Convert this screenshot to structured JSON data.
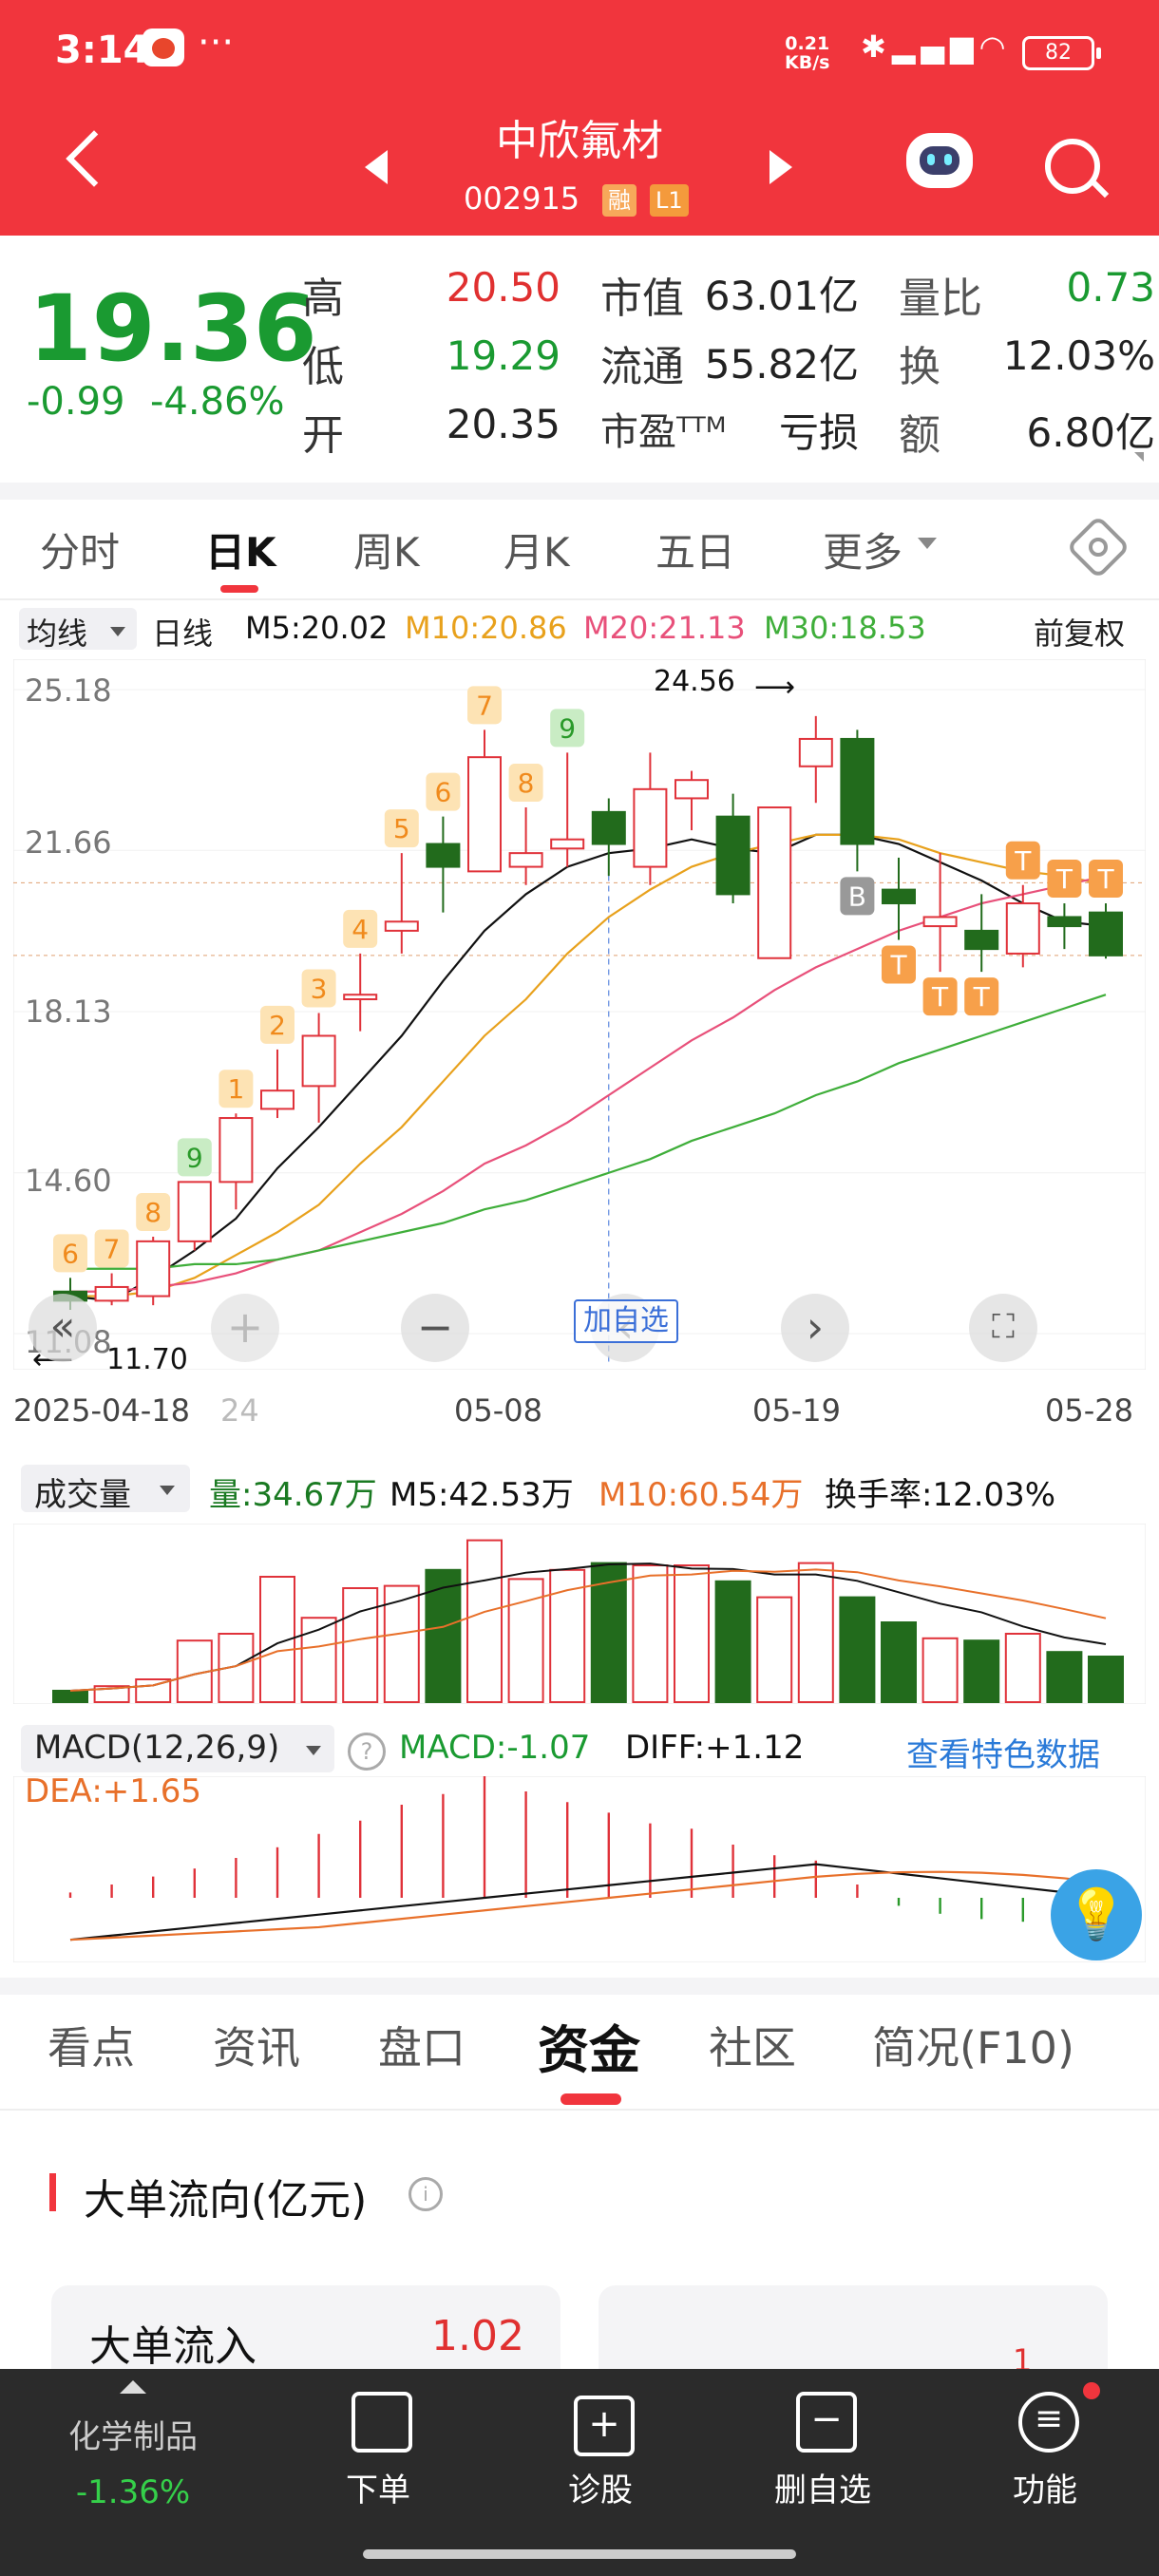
{
  "status_bar": {
    "time": "3:14",
    "dots": "···",
    "net_speed_value": "0.21",
    "net_speed_unit": "KB/s",
    "battery": "82"
  },
  "header": {
    "stock_name": "中欣氟材",
    "stock_code": "002915",
    "tag_margin": "融",
    "tag_level": "L1"
  },
  "quote": {
    "price": "19.36",
    "change": "-0.99",
    "change_pct": "-4.86%",
    "high_label": "高",
    "high": "20.50",
    "low_label": "低",
    "low": "19.29",
    "open_label": "开",
    "open": "20.35",
    "mkt_cap_label": "市值",
    "mkt_cap": "63.01亿",
    "float_cap_label": "流通",
    "float_cap": "55.82亿",
    "pe_label": "市盈ᵀᵀᴹ",
    "pe": "亏损",
    "vol_ratio_label": "量比",
    "vol_ratio": "0.73",
    "turnover_label": "换",
    "turnover": "12.03%",
    "amount_label": "额",
    "amount": "6.80亿"
  },
  "kline_tabs": [
    "分时",
    "日K",
    "周K",
    "月K",
    "五日",
    "更多"
  ],
  "kline_active": 1,
  "ma_bar": {
    "selector": "均线",
    "period": "日线",
    "m5": "M5:20.02",
    "m10": "M10:20.86",
    "m20": "M20:21.13",
    "m30": "M30:18.53",
    "adjust": "前复权"
  },
  "price_axis": [
    "25.18",
    "21.66",
    "18.13",
    "14.60",
    "11.08"
  ],
  "max_label": "24.56",
  "min_label": "11.70",
  "date_axis": [
    "2025-04-18",
    "24",
    "05-08",
    "05-19",
    "05-28"
  ],
  "chart_controls": {
    "add_watch": "加自选"
  },
  "candles": [
    {
      "o": 12.0,
      "c": 11.8,
      "h": 12.3,
      "l": 11.6
    },
    {
      "o": 11.8,
      "c": 12.1,
      "h": 12.4,
      "l": 11.7
    },
    {
      "o": 11.9,
      "c": 13.1,
      "h": 13.2,
      "l": 11.7
    },
    {
      "o": 13.1,
      "c": 14.4,
      "h": 14.4,
      "l": 12.9
    },
    {
      "o": 14.4,
      "c": 15.8,
      "h": 15.9,
      "l": 13.8
    },
    {
      "o": 16.0,
      "c": 16.4,
      "h": 17.3,
      "l": 15.8
    },
    {
      "o": 16.5,
      "c": 17.6,
      "h": 18.1,
      "l": 15.7
    },
    {
      "o": 18.4,
      "c": 18.5,
      "h": 19.4,
      "l": 17.7
    },
    {
      "o": 19.9,
      "c": 20.1,
      "h": 21.6,
      "l": 19.4
    },
    {
      "o": 21.8,
      "c": 21.3,
      "h": 22.4,
      "l": 20.3
    },
    {
      "o": 21.2,
      "c": 23.7,
      "h": 24.3,
      "l": 21.2
    },
    {
      "o": 21.3,
      "c": 21.6,
      "h": 22.6,
      "l": 20.9
    },
    {
      "o": 21.7,
      "c": 21.9,
      "h": 23.8,
      "l": 21.3
    },
    {
      "o": 22.5,
      "c": 21.8,
      "h": 22.8,
      "l": 21.1
    },
    {
      "o": 21.3,
      "c": 23.0,
      "h": 23.8,
      "l": 20.9
    },
    {
      "o": 22.8,
      "c": 23.2,
      "h": 23.4,
      "l": 22.1
    },
    {
      "o": 22.4,
      "c": 20.7,
      "h": 22.9,
      "l": 20.5
    },
    {
      "o": 19.3,
      "c": 22.6,
      "h": 22.6,
      "l": 19.3
    },
    {
      "o": 23.5,
      "c": 24.1,
      "h": 24.6,
      "l": 22.7
    },
    {
      "o": 24.1,
      "c": 21.8,
      "h": 24.3,
      "l": 21.2
    },
    {
      "o": 20.8,
      "c": 20.5,
      "h": 21.5,
      "l": 19.7
    },
    {
      "o": 20.0,
      "c": 20.2,
      "h": 21.6,
      "l": 19.0
    },
    {
      "o": 19.9,
      "c": 19.5,
      "h": 20.7,
      "l": 19.0
    },
    {
      "o": 19.4,
      "c": 20.5,
      "h": 20.9,
      "l": 19.1
    },
    {
      "o": 20.2,
      "c": 20.0,
      "h": 20.5,
      "l": 19.5
    },
    {
      "o": 20.3,
      "c": 19.36,
      "h": 20.5,
      "l": 19.29
    }
  ],
  "ma_lines": {
    "m5": [
      11.9,
      11.8,
      12.3,
      12.9,
      13.6,
      14.7,
      15.6,
      16.6,
      17.6,
      18.8,
      19.9,
      20.7,
      21.3,
      21.6,
      21.7,
      21.9,
      21.7,
      21.6,
      22.0,
      22.0,
      21.8,
      21.4,
      21.0,
      20.5,
      20.1,
      20.0
    ],
    "m10": [
      11.9,
      11.9,
      12.0,
      12.3,
      12.8,
      13.3,
      13.9,
      14.8,
      15.6,
      16.6,
      17.6,
      18.4,
      19.4,
      20.2,
      20.8,
      21.3,
      21.6,
      21.8,
      22.0,
      22.0,
      21.9,
      21.6,
      21.4,
      21.2,
      21.1,
      20.9
    ],
    "m20": [
      12.0,
      12.0,
      12.1,
      12.2,
      12.4,
      12.7,
      12.9,
      13.3,
      13.7,
      14.2,
      14.8,
      15.2,
      15.7,
      16.3,
      16.9,
      17.5,
      18.0,
      18.6,
      19.1,
      19.5,
      19.9,
      20.2,
      20.5,
      20.7,
      20.9,
      21.1
    ],
    "m30": [
      12.5,
      12.5,
      12.5,
      12.6,
      12.6,
      12.7,
      12.9,
      13.1,
      13.3,
      13.5,
      13.8,
      14.0,
      14.3,
      14.6,
      14.9,
      15.3,
      15.6,
      15.9,
      16.3,
      16.6,
      17.0,
      17.3,
      17.6,
      17.9,
      18.2,
      18.5
    ]
  },
  "signal_marks": [
    {
      "i": 0,
      "t": "6",
      "kind": "num"
    },
    {
      "i": 1,
      "t": "7",
      "kind": "num"
    },
    {
      "i": 2,
      "t": "8",
      "kind": "num"
    },
    {
      "i": 3,
      "t": "9",
      "kind": "green"
    },
    {
      "i": 4,
      "t": "1",
      "kind": "num"
    },
    {
      "i": 5,
      "t": "2",
      "kind": "num"
    },
    {
      "i": 6,
      "t": "3",
      "kind": "num"
    },
    {
      "i": 7,
      "t": "4",
      "kind": "num"
    },
    {
      "i": 8,
      "t": "5",
      "kind": "num"
    },
    {
      "i": 9,
      "t": "6",
      "kind": "num"
    },
    {
      "i": 10,
      "t": "7",
      "kind": "num"
    },
    {
      "i": 11,
      "t": "8",
      "kind": "num"
    },
    {
      "i": 12,
      "t": "9",
      "kind": "green"
    },
    {
      "i": 19,
      "t": "B",
      "kind": "gray"
    },
    {
      "i": 20,
      "t": "T",
      "kind": "tlow"
    },
    {
      "i": 21,
      "t": "T",
      "kind": "tlow"
    },
    {
      "i": 22,
      "t": "T",
      "kind": "tlow"
    },
    {
      "i": 23,
      "t": "T",
      "kind": "thigh"
    },
    {
      "i": 24,
      "t": "T",
      "kind": "thigh"
    },
    {
      "i": 25,
      "t": "T",
      "kind": "thigh"
    }
  ],
  "volume": {
    "selector": "成交量",
    "vol": "量:34.67万",
    "m5": "M5:42.53万",
    "m10": "M10:60.54万",
    "turnover": "换手率:12.03%",
    "bars": [
      5,
      7,
      10,
      27,
      30,
      55,
      37,
      50,
      51,
      58,
      71,
      54,
      58,
      61,
      60,
      60,
      53,
      46,
      61,
      46,
      35,
      28,
      27,
      30,
      22,
      20
    ]
  },
  "macd": {
    "selector": "MACD(12,26,9)",
    "macd": "MACD:-1.07",
    "diff": "DIFF:+1.12",
    "dea": "DEA:+1.65",
    "feature_link": "查看特色数据",
    "hist": [
      0.2,
      0.5,
      0.8,
      1.1,
      1.5,
      1.9,
      2.4,
      2.9,
      3.5,
      3.9,
      4.6,
      4.0,
      3.6,
      3.2,
      2.8,
      2.6,
      2.0,
      1.6,
      1.4,
      0.5,
      -0.3,
      -0.6,
      -0.8,
      -0.9,
      -1.0,
      -1.07
    ]
  },
  "sub_tabs": [
    "看点",
    "资讯",
    "盘口",
    "资金",
    "社区",
    "简况(F10)"
  ],
  "sub_active": 3,
  "fund_section": {
    "title": "大单流向(亿元)",
    "inflow_label": "大单流入",
    "inflow_value": "1.02",
    "right_card_value": "1"
  },
  "bottom_nav": {
    "sector_name": "化学制品",
    "sector_change": "-1.36%",
    "order": "下单",
    "diagnose": "诊股",
    "remove_watch": "删自选",
    "functions": "功能"
  }
}
